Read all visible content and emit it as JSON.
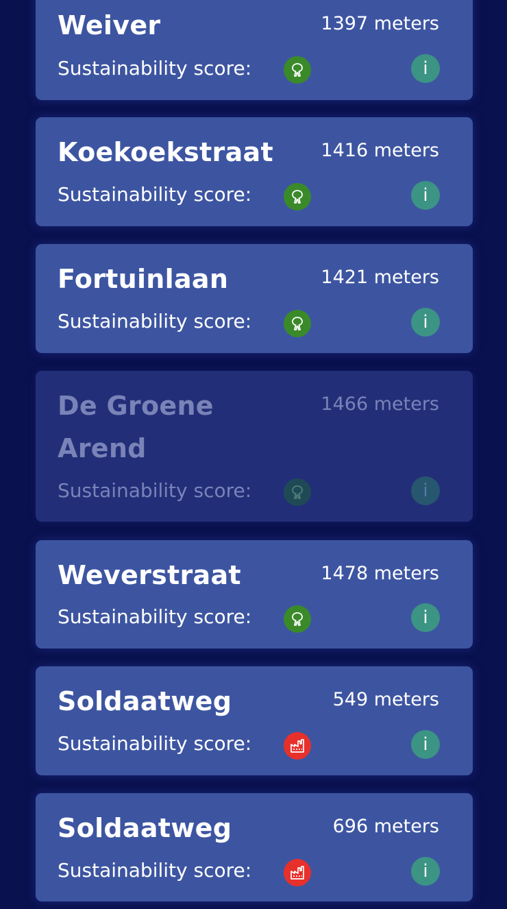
{
  "score_label": "Sustainability score:",
  "info_label": "i",
  "colors": {
    "background": "#0a114f",
    "card": "#3d55a1",
    "card_disabled": "#222f78",
    "tree_score": "#3a8a2a",
    "factory_score": "#e8302b",
    "info_button": "#3c9484"
  },
  "locations": [
    {
      "name": "Weiver",
      "distance": "1397 meters",
      "score_icon": "tree-icon",
      "disabled": false
    },
    {
      "name": "Koekoekstraat",
      "distance": "1416 meters",
      "score_icon": "tree-icon",
      "disabled": false
    },
    {
      "name": "Fortuinlaan",
      "distance": "1421 meters",
      "score_icon": "tree-icon",
      "disabled": false
    },
    {
      "name": "De Groene Arend",
      "distance": "1466 meters",
      "score_icon": "tree-icon",
      "disabled": true
    },
    {
      "name": "Weverstraat",
      "distance": "1478 meters",
      "score_icon": "tree-icon",
      "disabled": false
    },
    {
      "name": "Soldaatweg",
      "distance": "549 meters",
      "score_icon": "factory-icon",
      "disabled": false
    },
    {
      "name": "Soldaatweg",
      "distance": "696 meters",
      "score_icon": "factory-icon",
      "disabled": false
    }
  ]
}
